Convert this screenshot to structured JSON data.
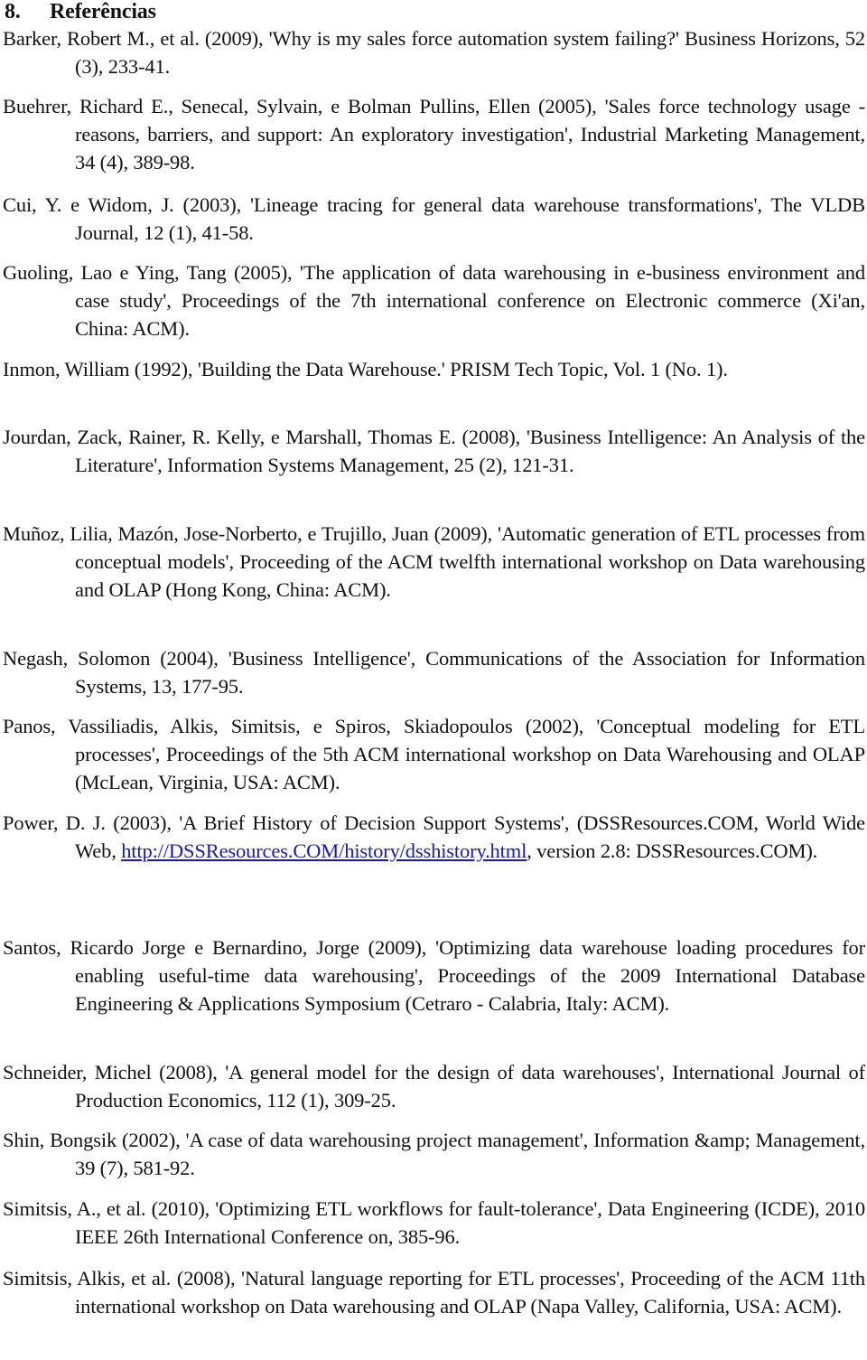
{
  "section": {
    "number": "8.",
    "title": "Referências"
  },
  "references": [
    {
      "text": "Barker, Robert M., et al. (2009), 'Why is my sales force automation system failing?' Business Horizons, 52 (3), 233-41."
    },
    {
      "text": "Buehrer, Richard E., Senecal, Sylvain, e Bolman Pullins, Ellen (2005), 'Sales force technology usage - reasons, barriers, and support: An exploratory investigation', Industrial Marketing Management, 34 (4), 389-98."
    },
    {
      "text": "Cui, Y. e Widom, J. (2003), 'Lineage tracing for general data warehouse transformations', The VLDB Journal, 12 (1), 41-58."
    },
    {
      "text": "Guoling, Lao e Ying, Tang (2005), 'The application of data warehousing in e-business environment and case study', Proceedings of the 7th international conference on Electronic commerce (Xi'an, China: ACM)."
    },
    {
      "text": "Inmon, William (1992), 'Building the Data Warehouse.' PRISM Tech Topic, Vol. 1 (No. 1)."
    },
    {
      "text": "Jourdan, Zack, Rainer, R. Kelly, e Marshall, Thomas E. (2008), 'Business Intelligence: An Analysis of the Literature', Information Systems Management, 25 (2), 121-31."
    },
    {
      "text": "Muñoz, Lilia, Mazón, Jose-Norberto, e Trujillo, Juan (2009), 'Automatic generation of ETL processes from conceptual models', Proceeding of the ACM twelfth international workshop on Data warehousing and OLAP (Hong Kong, China: ACM)."
    },
    {
      "text": "Negash, Solomon (2004), 'Business Intelligence', Communications of the Association for Information Systems, 13, 177-95."
    },
    {
      "text": "Panos, Vassiliadis, Alkis, Simitsis, e Spiros, Skiadopoulos (2002), 'Conceptual modeling for ETL processes', Proceedings of the 5th ACM international workshop on Data Warehousing and OLAP (McLean, Virginia, USA: ACM)."
    },
    {
      "before": "Power, D. J. (2003), 'A Brief History of Decision Support Systems', (DSSResources.COM, World Wide Web,",
      "link": "http://DSSResources.COM/history/dsshistory.html",
      "after": ", version 2.8: DSSResources.COM)."
    },
    {
      "text": "Santos, Ricardo Jorge e Bernardino, Jorge (2009), 'Optimizing data warehouse loading procedures for enabling useful-time data warehousing', Proceedings of the 2009 International Database Engineering & Applications Symposium (Cetraro - Calabria, Italy: ACM)."
    },
    {
      "text": "Schneider, Michel (2008), 'A general model for the design of data warehouses', International Journal of Production Economics, 112 (1), 309-25."
    },
    {
      "text": "Shin, Bongsik (2002), 'A case of data warehousing project management', Information &amp; Management, 39 (7), 581-92."
    },
    {
      "text": "Simitsis, A., et al. (2010), 'Optimizing ETL workflows for fault-tolerance', Data Engineering (ICDE), 2010 IEEE 26th International Conference on, 385-96."
    },
    {
      "text": "Simitsis, Alkis, et al. (2008), 'Natural language reporting for ETL processes', Proceeding of the ACM 11th international workshop on Data warehousing and OLAP (Napa Valley, California, USA: ACM)."
    }
  ],
  "colors": {
    "text": "#111111",
    "link": "#1a1aa6",
    "background": "#ffffff"
  }
}
